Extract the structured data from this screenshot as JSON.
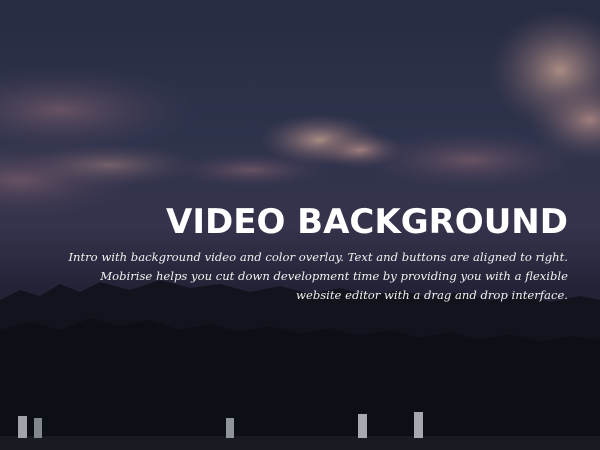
{
  "hero": {
    "title": "VIDEO BACKGROUND",
    "subtitle_lines": [
      "Intro with background video and color overlay. Text and buttons are aligned to right.",
      "Mobirise helps you cut down development time by providing you with a flexible",
      "website editor with a drag and drop interface."
    ],
    "text_color": "#ffffff",
    "overlay_color": "#141628"
  }
}
